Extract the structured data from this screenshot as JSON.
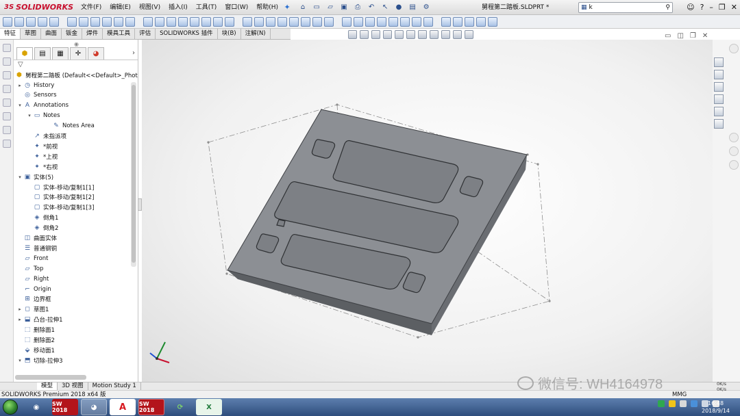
{
  "app": {
    "logo_text": "SOLIDWORKS",
    "logo_mark": "3S",
    "document_title": "舅程第二踏板.SLDPRT *"
  },
  "menu": {
    "items": [
      "文件(F)",
      "编辑(E)",
      "视图(V)",
      "插入(I)",
      "工具(T)",
      "窗口(W)",
      "帮助(H)"
    ]
  },
  "search": {
    "value": "k"
  },
  "command_tabs": [
    "特征",
    "草图",
    "曲面",
    "钣金",
    "焊件",
    "模具工具",
    "评估",
    "SOLIDWORKS 插件",
    "块(B)",
    "注解(N)"
  ],
  "feature_tree": {
    "root": "舅程第二踏板 (Default<<Default>_Phot",
    "nodes": [
      {
        "label": "History",
        "icon": "history-icon",
        "expand": "▸",
        "indent": 0
      },
      {
        "label": "Sensors",
        "icon": "sensor-icon",
        "expand": "",
        "indent": 0
      },
      {
        "label": "Annotations",
        "icon": "annotation-icon",
        "expand": "▾",
        "indent": 0
      },
      {
        "label": "Notes",
        "icon": "notes-folder-icon",
        "expand": "▾",
        "indent": 1
      },
      {
        "label": "Notes Area",
        "icon": "notes-area-icon",
        "expand": "",
        "indent": 3
      },
      {
        "label": "未指派项",
        "icon": "unassigned-icon",
        "expand": "",
        "indent": 1
      },
      {
        "label": "*前视",
        "icon": "view-icon",
        "expand": "",
        "indent": 1
      },
      {
        "label": "*上视",
        "icon": "view-icon",
        "expand": "",
        "indent": 1
      },
      {
        "label": "*右视",
        "icon": "view-icon",
        "expand": "",
        "indent": 1
      },
      {
        "label": "实体(5)",
        "icon": "solid-bodies-icon",
        "expand": "▾",
        "indent": 0
      },
      {
        "label": "实体-移动/复制1[1]",
        "icon": "body-icon",
        "expand": "",
        "indent": 1
      },
      {
        "label": "实体-移动/复制1[2]",
        "icon": "body-icon",
        "expand": "",
        "indent": 1
      },
      {
        "label": "实体-移动/复制1[3]",
        "icon": "body-icon",
        "expand": "",
        "indent": 1
      },
      {
        "label": "倒角1",
        "icon": "chamfer-icon",
        "expand": "",
        "indent": 1
      },
      {
        "label": "倒角2",
        "icon": "chamfer-icon",
        "expand": "",
        "indent": 1
      },
      {
        "label": "曲面实体",
        "icon": "surface-bodies-icon",
        "expand": "",
        "indent": 0
      },
      {
        "label": "普通钢铜",
        "icon": "material-icon",
        "expand": "",
        "indent": 0
      },
      {
        "label": "Front",
        "icon": "plane-icon",
        "expand": "",
        "indent": 0
      },
      {
        "label": "Top",
        "icon": "plane-icon",
        "expand": "",
        "indent": 0
      },
      {
        "label": "Right",
        "icon": "plane-icon",
        "expand": "",
        "indent": 0
      },
      {
        "label": "Origin",
        "icon": "origin-icon",
        "expand": "",
        "indent": 0
      },
      {
        "label": "边界框",
        "icon": "bounding-box-icon",
        "expand": "",
        "indent": 0
      },
      {
        "label": "草图1",
        "icon": "sketch-icon",
        "expand": "▸",
        "indent": 0
      },
      {
        "label": "凸台-拉伸1",
        "icon": "extrude-icon",
        "expand": "▸",
        "indent": 0
      },
      {
        "label": "删除面1",
        "icon": "delete-face-icon",
        "expand": "",
        "indent": 0
      },
      {
        "label": "删除面2",
        "icon": "delete-face-icon",
        "expand": "",
        "indent": 0
      },
      {
        "label": "移动面1",
        "icon": "move-face-icon",
        "expand": "",
        "indent": 0
      },
      {
        "label": "切除-拉伸3",
        "icon": "cut-extrude-icon",
        "expand": "▾",
        "indent": 0
      }
    ]
  },
  "bottom_tabs": [
    "模型",
    "3D 视图",
    "Motion Study 1"
  ],
  "status": {
    "product": "SOLIDWORKS Premium 2018 x64 版",
    "units": "MMG",
    "net_up": "0K/s",
    "net_down": "0K/s"
  },
  "watermark": "微信号: WH4164978",
  "taskbar": {
    "items": [
      "SW 2018",
      "",
      "A",
      "SW 2018",
      "",
      ""
    ],
    "time": "16:48",
    "date": "2018/9/14"
  },
  "colors": {
    "part_top": "#8c8f94",
    "part_side": "#5c5f63",
    "logo": "#c8102e"
  }
}
